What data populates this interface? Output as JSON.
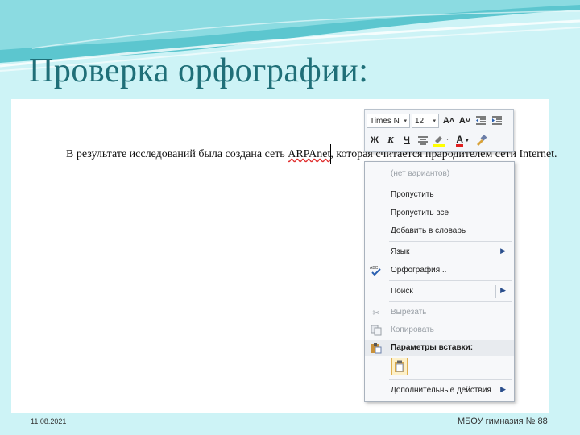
{
  "slide": {
    "title": "Проверка орфографии:",
    "footer_date": "11.08.2021",
    "footer_school": "МБОУ гимназия № 88"
  },
  "document": {
    "text_before": "В результате исследований была создана сеть ",
    "misspelled_word": "ARPAnet",
    "text_after": ", которая считается прародителем сети Internet."
  },
  "mini_toolbar": {
    "font_name": "Times N",
    "font_size": "12",
    "grow_font": "A˄",
    "shrink_font": "A˅",
    "bold": "Ж",
    "italic": "К",
    "underline": "Ч",
    "font_color_letter": "A"
  },
  "context_menu": {
    "items": [
      {
        "label": "(нет вариантов)"
      },
      {
        "label": "Пропустить"
      },
      {
        "label": "Пропустить все"
      },
      {
        "label": "Добавить в словарь"
      },
      {
        "label": "Язык"
      },
      {
        "label": "Орфография..."
      },
      {
        "label": "Поиск"
      },
      {
        "label": "Вырезать"
      },
      {
        "label": "Копировать"
      },
      {
        "label": "Параметры вставки:"
      },
      {
        "label": "Дополнительные действия"
      }
    ]
  },
  "colors": {
    "slide_bg": "#cdf3f6",
    "title": "#1f6f78",
    "misspell_underline": "#e03030",
    "menu_arrow": "#2a4e8c"
  }
}
